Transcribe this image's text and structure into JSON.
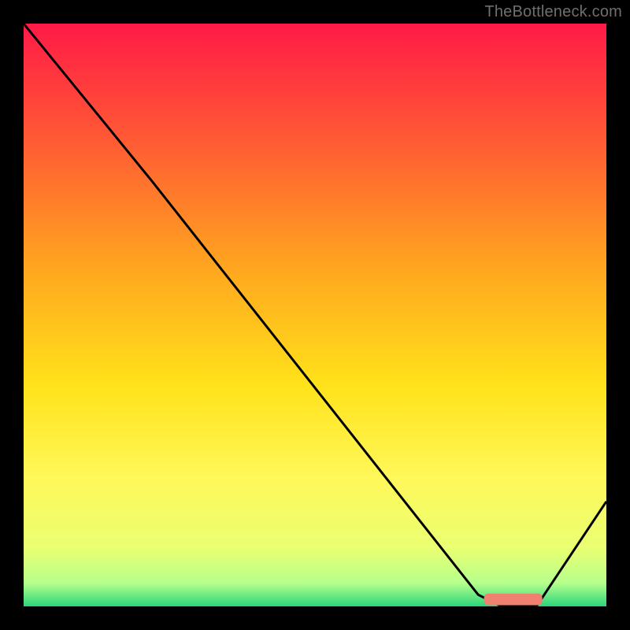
{
  "watermark": {
    "text": "TheBottleneck.com"
  },
  "chart_data": {
    "type": "line",
    "title": "",
    "xlabel": "",
    "ylabel": "",
    "xlim": [
      0,
      100
    ],
    "ylim": [
      0,
      100
    ],
    "grid": false,
    "background_gradient": {
      "stops": [
        {
          "pos": 0.0,
          "color": "#ff1a47"
        },
        {
          "pos": 0.2,
          "color": "#ff5a34"
        },
        {
          "pos": 0.42,
          "color": "#ffa61f"
        },
        {
          "pos": 0.62,
          "color": "#ffe21a"
        },
        {
          "pos": 0.78,
          "color": "#fff85a"
        },
        {
          "pos": 0.9,
          "color": "#eaff72"
        },
        {
          "pos": 0.96,
          "color": "#b6ff8c"
        },
        {
          "pos": 1.0,
          "color": "#2bd67b"
        }
      ]
    },
    "series": [
      {
        "name": "bottleneck-curve",
        "color": "#000000",
        "x": [
          0,
          22,
          78,
          82,
          88,
          100
        ],
        "values": [
          100,
          73,
          2,
          0,
          0,
          18
        ]
      }
    ],
    "marker": {
      "name": "optimal-range",
      "color": "#f08070",
      "x_start": 79,
      "x_end": 89,
      "y": 1.2,
      "thickness": 2.0
    }
  }
}
